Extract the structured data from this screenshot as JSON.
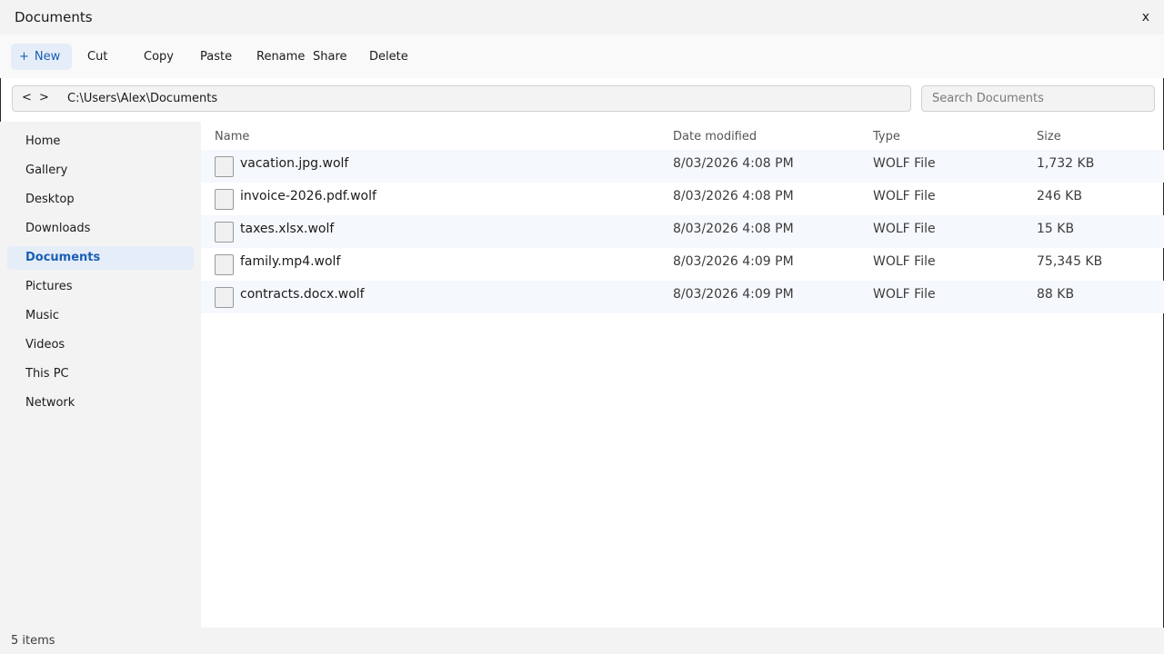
{
  "window": {
    "title": "Documents",
    "close_label": "x"
  },
  "toolbar": {
    "new_icon": "+",
    "new_label": "New",
    "cut_label": "Cut",
    "copy_label": "Copy",
    "paste_label": "Paste",
    "rename_label": "Rename",
    "share_label": "Share",
    "delete_label": "Delete"
  },
  "address": {
    "back": "<",
    "forward": ">",
    "path": "C:\\Users\\Alex\\Documents",
    "search_placeholder": "Search Documents"
  },
  "sidebar": {
    "items": [
      {
        "label": "Home"
      },
      {
        "label": "Gallery"
      },
      {
        "label": "Desktop"
      },
      {
        "label": "Downloads"
      },
      {
        "label": "Documents",
        "active": true
      },
      {
        "label": "Pictures"
      },
      {
        "label": "Music"
      },
      {
        "label": "Videos"
      },
      {
        "label": "This PC"
      },
      {
        "label": "Network"
      }
    ]
  },
  "columns": {
    "name": "Name",
    "date": "Date modified",
    "type": "Type",
    "size": "Size"
  },
  "files": [
    {
      "name": "vacation.jpg.wolf",
      "date": "8/03/2026 4:08 PM",
      "type": "WOLF File",
      "size": "1,732 KB"
    },
    {
      "name": "invoice-2026.pdf.wolf",
      "date": "8/03/2026 4:08 PM",
      "type": "WOLF File",
      "size": "246 KB"
    },
    {
      "name": "taxes.xlsx.wolf",
      "date": "8/03/2026 4:08 PM",
      "type": "WOLF File",
      "size": "15 KB"
    },
    {
      "name": "family.mp4.wolf",
      "date": "8/03/2026 4:09 PM",
      "type": "WOLF File",
      "size": "75,345 KB"
    },
    {
      "name": "contracts.docx.wolf",
      "date": "8/03/2026 4:09 PM",
      "type": "WOLF File",
      "size": "88 KB"
    }
  ],
  "status": {
    "item_count": "5 items"
  },
  "colors": {
    "accent": "#1a5fb4",
    "selected_bg": "#e5edf8",
    "alt_row_bg": "#f5f8fc"
  }
}
